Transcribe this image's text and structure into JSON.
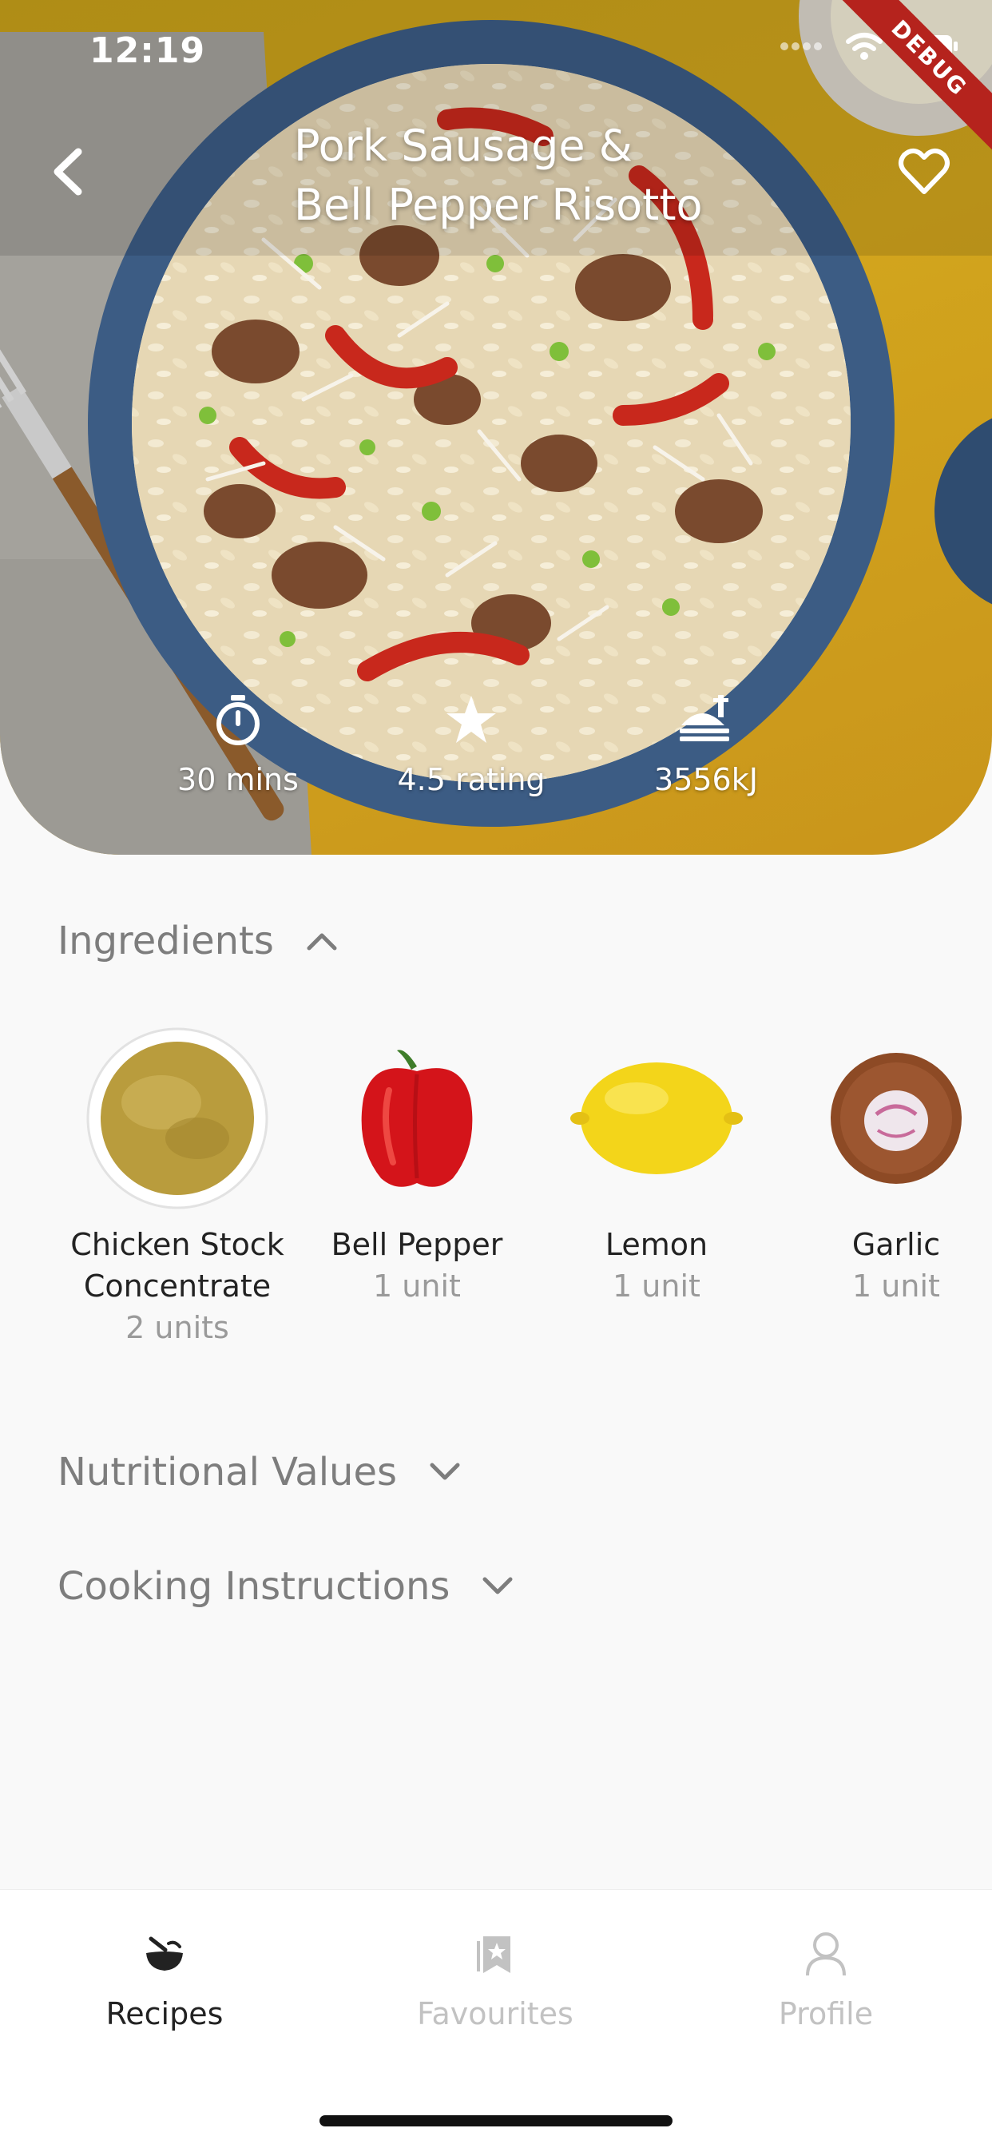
{
  "status_bar": {
    "time": "12:19",
    "debug_label": "DEBUG"
  },
  "recipe": {
    "title_line1": "Pork Sausage &",
    "title_line2": "Bell Pepper Risotto",
    "stats": {
      "time": "30 mins",
      "rating": "4.5 rating",
      "energy": "3556kJ"
    }
  },
  "sections": {
    "ingredients": "Ingredients",
    "nutrition": "Nutritional Values",
    "cooking": "Cooking Instructions"
  },
  "ingredients": [
    {
      "name_line1": "Chicken Stock",
      "name_line2": "Concentrate",
      "qty": "2 units"
    },
    {
      "name_line1": "Bell Pepper",
      "name_line2": "",
      "qty": "1 unit"
    },
    {
      "name_line1": "Lemon",
      "name_line2": "",
      "qty": "1 unit"
    },
    {
      "name_line1": "Garlic",
      "name_line2": "",
      "qty": "1 unit"
    }
  ],
  "nav": {
    "recipes": "Recipes",
    "favourites": "Favourites",
    "profile": "Profile"
  },
  "colors": {
    "hero_bg": "#c8a11a",
    "bowl": "#3f5f86",
    "nav_active": "#222222",
    "nav_inactive": "#c2c2c2",
    "section_text": "#7d7d7d"
  }
}
